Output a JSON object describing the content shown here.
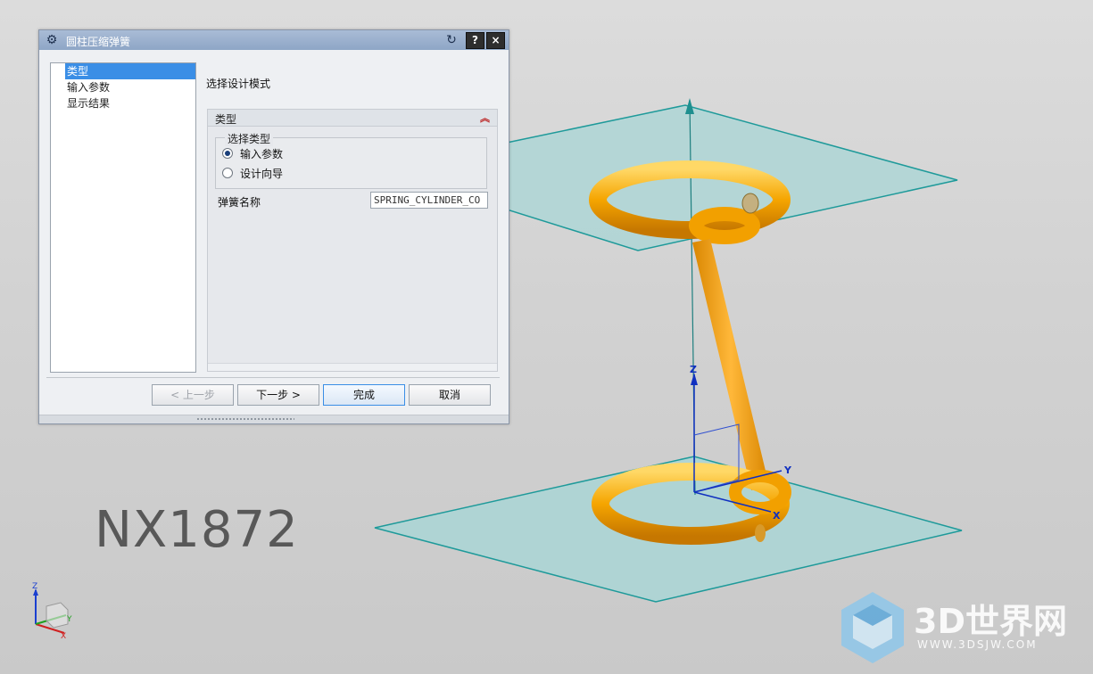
{
  "dialog": {
    "title": "圆柱压缩弹簧",
    "help_label": "?",
    "close_label": "×",
    "nav_items": [
      {
        "label": "类型",
        "selected": true
      },
      {
        "label": "输入参数",
        "selected": false
      },
      {
        "label": "显示结果",
        "selected": false
      }
    ],
    "mode_label": "选择设计模式",
    "group_title": "类型",
    "subgroup_legend": "选择类型",
    "options": [
      {
        "label": "输入参数",
        "checked": true
      },
      {
        "label": "设计向导",
        "checked": false
      }
    ],
    "spring_name_label": "弹簧名称",
    "spring_name_value": "SPRING_CYLINDER_CO",
    "buttons": {
      "back": "< 上一步",
      "next": "下一步 >",
      "finish": "完成",
      "cancel": "取消"
    }
  },
  "viewport": {
    "product_label": "NX1872",
    "axis_labels": {
      "z": "Z",
      "y": "Y",
      "x": "X"
    },
    "watermark_text": "3D世界网",
    "watermark_url": "WWW.3DSJW.COM"
  },
  "colors": {
    "plane_fill": "#9fd2d2",
    "plane_edge": "#1e9a9a",
    "spring": "#f5a500",
    "selection": "#3a8ee6"
  }
}
